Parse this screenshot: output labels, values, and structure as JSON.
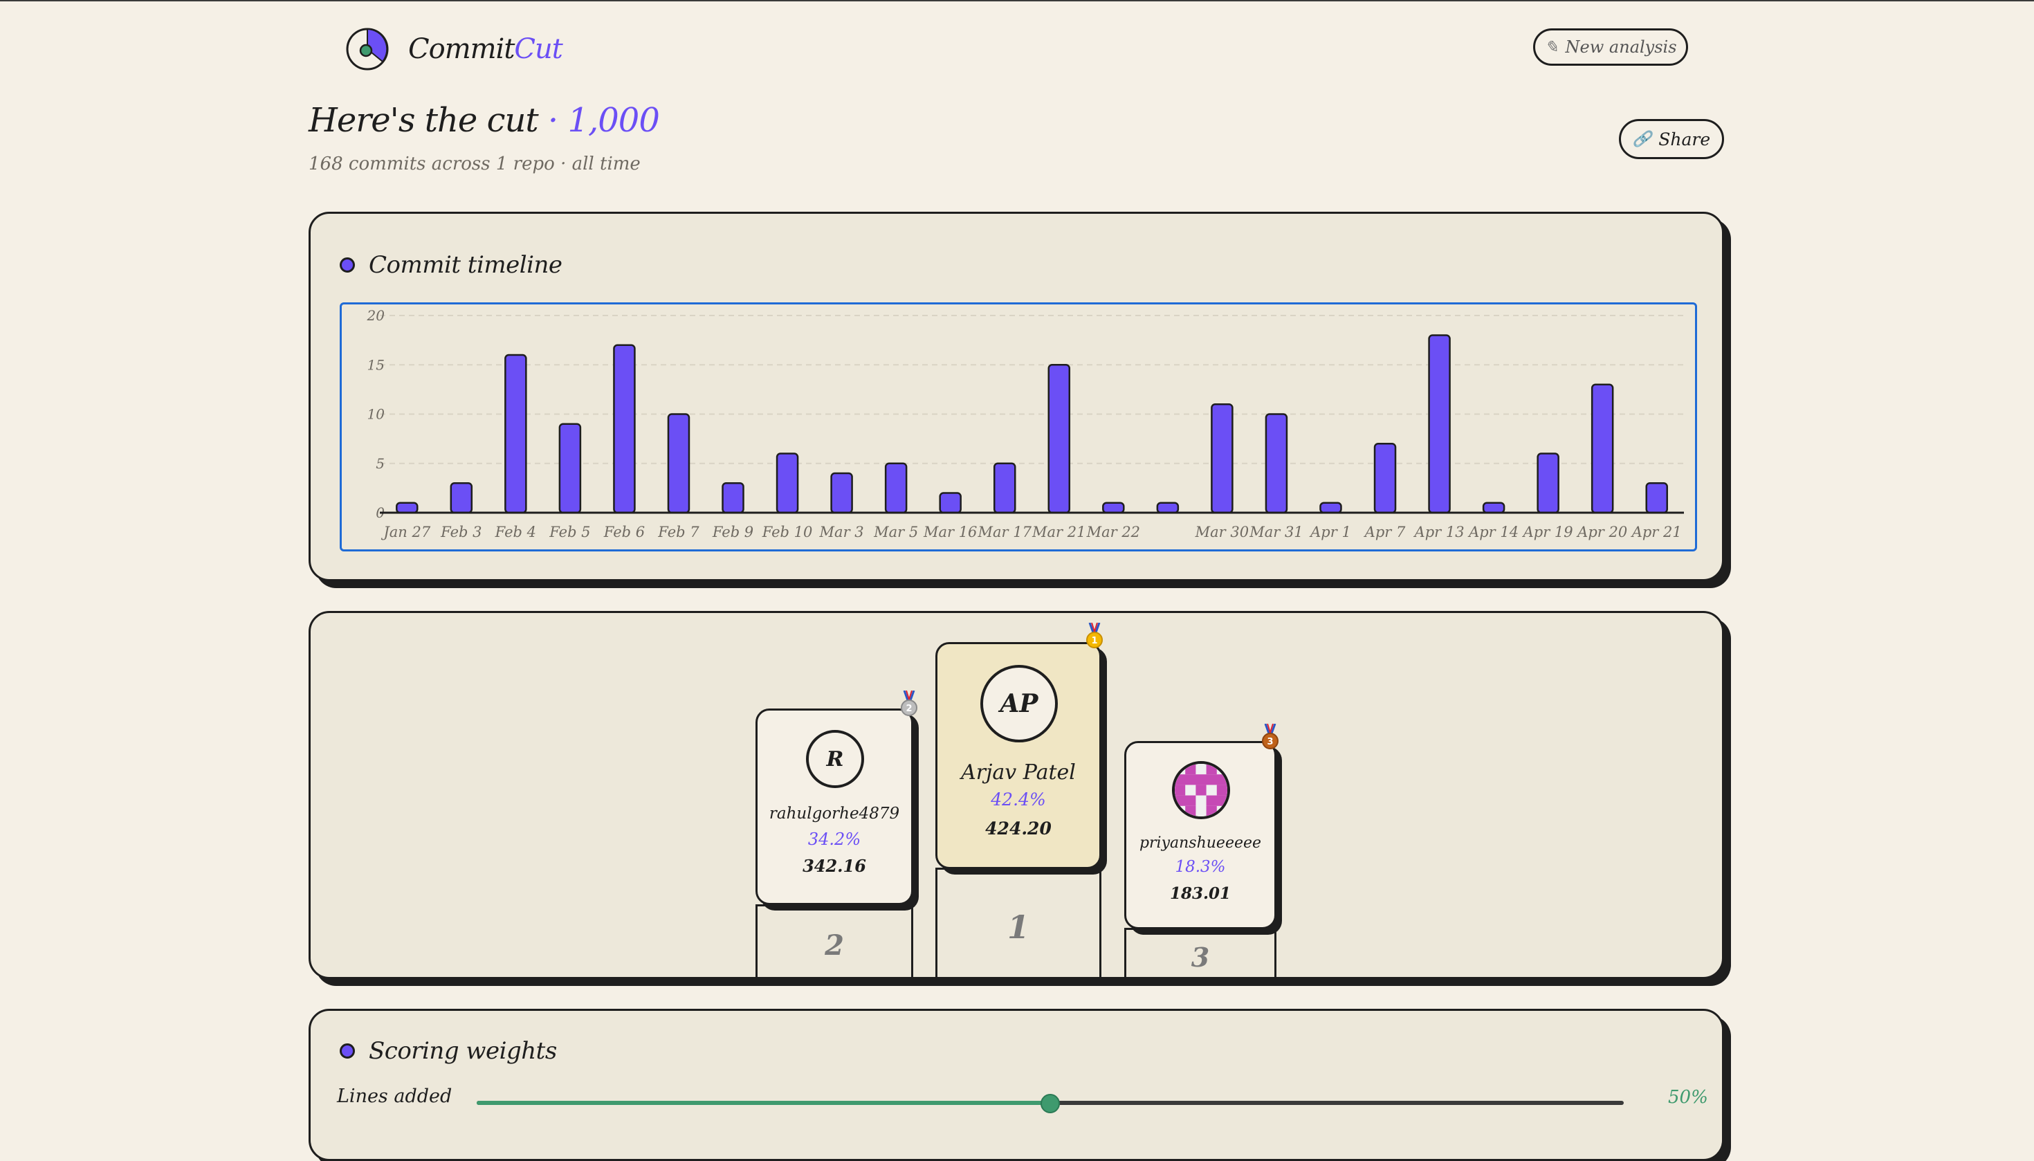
{
  "header": {
    "brand_primary": "Commit",
    "brand_accent": "Cut",
    "new_analysis_label": "New analysis",
    "share_label": "Share"
  },
  "summary": {
    "title": "Here's the cut",
    "score": "· 1,000",
    "subtitle": "168 commits across 1 repo · all time"
  },
  "timeline": {
    "title": "Commit timeline"
  },
  "chart_data": {
    "type": "bar",
    "categories": [
      "Jan 27",
      "Feb 3",
      "Feb 4",
      "Feb 5",
      "Feb 6",
      "Feb 7",
      "Feb 9",
      "Feb 10",
      "Mar 3",
      "Mar 5",
      "Mar 16",
      "Mar 17",
      "Mar 21",
      "Mar 22",
      "",
      "Mar 30",
      "Mar 31",
      "Apr 1",
      "Apr 7",
      "Apr 13",
      "Apr 14",
      "Apr 19",
      "Apr 20",
      "Apr 21"
    ],
    "values": [
      1,
      3,
      16,
      9,
      17,
      10,
      3,
      6,
      4,
      5,
      2,
      5,
      15,
      1,
      1,
      11,
      10,
      1,
      7,
      18,
      1,
      6,
      13,
      3
    ],
    "yticks": [
      0,
      5,
      10,
      15,
      20
    ],
    "ylim": [
      0,
      20
    ],
    "grid": true,
    "bar_color": "#6b4ff5"
  },
  "podium": [
    {
      "rank": "1",
      "initials": "AP",
      "name": "Arjav Patel",
      "percent": "42.4%",
      "score": "424.20",
      "base_color": "#ffd84d"
    },
    {
      "rank": "2",
      "initials": "R",
      "name": "rahulgorhe4879",
      "percent": "34.2%",
      "score": "342.16",
      "base_color": "#d8d8d8"
    },
    {
      "rank": "3",
      "initials": "",
      "name": "priyanshueeeee",
      "percent": "18.3%",
      "score": "183.01",
      "base_color": "#e0aa6c"
    }
  ],
  "weights": {
    "title": "Scoring weights",
    "items": [
      {
        "label": "Lines added",
        "value": 50,
        "display": "50%"
      }
    ]
  },
  "colors": {
    "accent": "#6b4ff5",
    "slider": "#3f9a6e"
  }
}
